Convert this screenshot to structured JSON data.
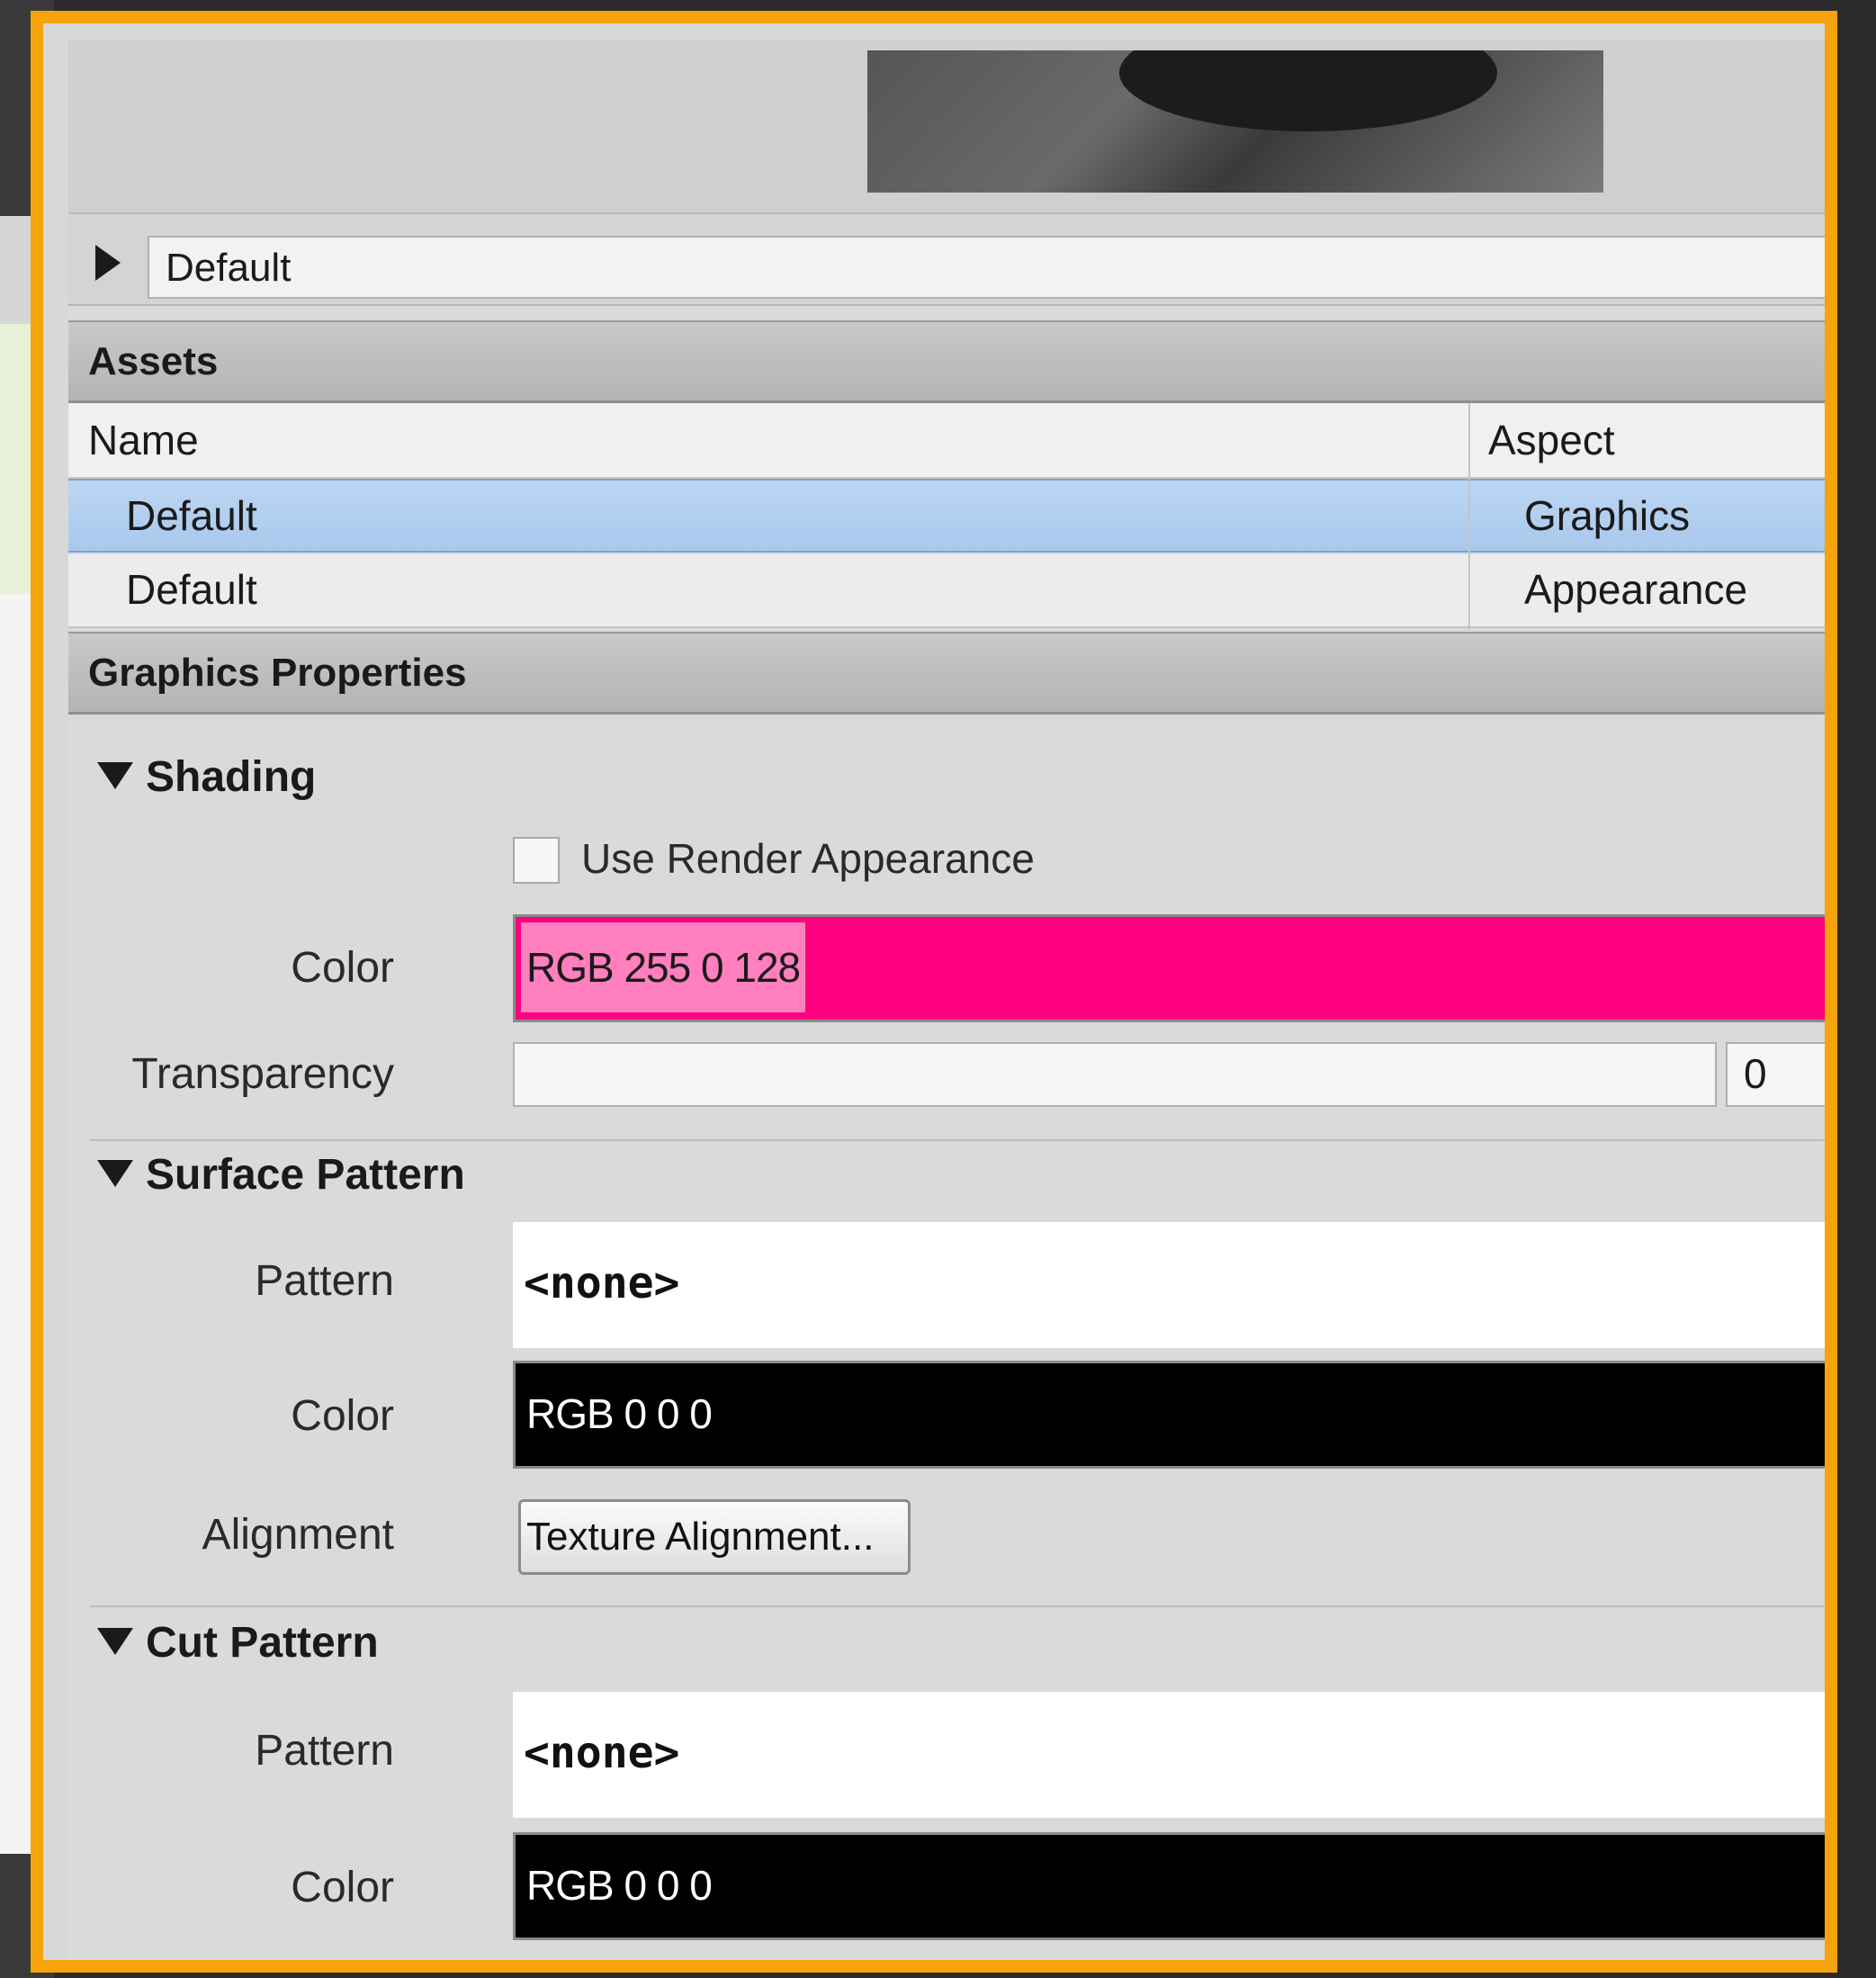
{
  "header": {
    "name_value": "Default"
  },
  "assets": {
    "title": "Assets",
    "columns": {
      "name": "Name",
      "aspect": "Aspect"
    },
    "rows": [
      {
        "name": "Default",
        "aspect": "Graphics"
      },
      {
        "name": "Default",
        "aspect": "Appearance"
      }
    ]
  },
  "graphics": {
    "title": "Graphics Properties",
    "shading": {
      "title": "Shading",
      "use_render_label": "Use Render Appearance",
      "use_render_checked": false,
      "color_label": "Color",
      "color_value": "RGB 255 0 128",
      "color_hex": "#ff0080",
      "transparency_label": "Transparency",
      "transparency_value": "0"
    },
    "surface_pattern": {
      "title": "Surface Pattern",
      "pattern_label": "Pattern",
      "pattern_value": "<none>",
      "color_label": "Color",
      "color_value": "RGB 0 0 0",
      "color_hex": "#000000",
      "alignment_label": "Alignment",
      "alignment_button": "Texture Alignment..."
    },
    "cut_pattern": {
      "title": "Cut Pattern",
      "pattern_label": "Pattern",
      "pattern_value": "<none>",
      "color_label": "Color",
      "color_value": "RGB 0 0 0",
      "color_hex": "#000000"
    }
  },
  "colors": {
    "highlight_border": "#f7a30b",
    "selected_row": "#a9c8ec"
  }
}
